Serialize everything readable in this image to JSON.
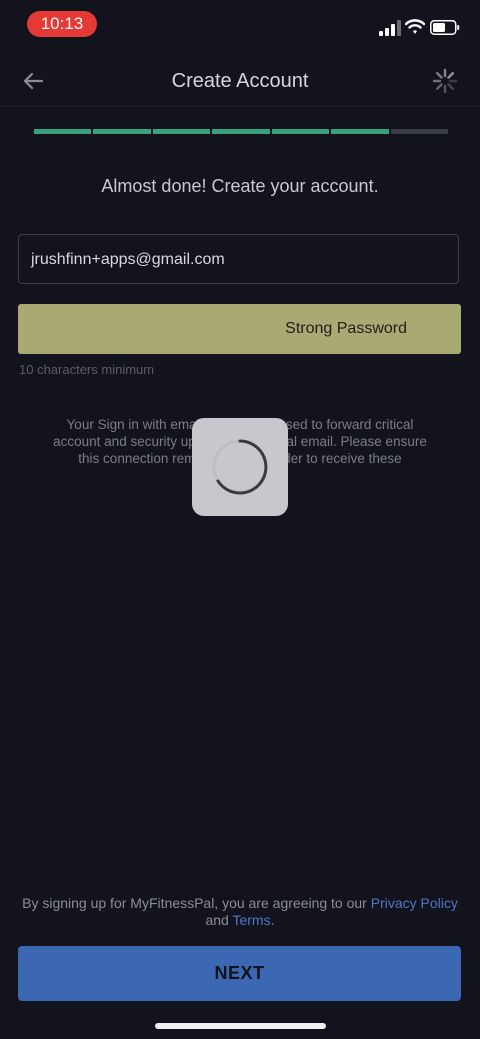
{
  "status": {
    "time": "10:13",
    "icons": [
      "cellular-signal-icon",
      "wifi-icon",
      "battery-icon"
    ]
  },
  "nav": {
    "title": "Create Account",
    "back_icon": "back-arrow-icon",
    "loading_icon": "spinner-icon"
  },
  "progress": {
    "total_steps": 7,
    "completed_steps": 6
  },
  "heading": "Almost done! Create your account.",
  "email": {
    "value": "jrushfinn+apps@gmail.com"
  },
  "password": {
    "strength_label": "Strong Password",
    "hint": "10 characters minimum"
  },
  "info": {
    "line1": "Your Sign in with email a          used to forward critical",
    "line2": "account and security upda        sonal email. Please ensure",
    "line3": "this connection remain         order to receive these"
  },
  "terms": {
    "prefix": "By signing up for MyFitnessPal, you are agreeing to our ",
    "privacy_link": "Privacy Policy",
    "and": " and ",
    "terms_link": "Terms",
    "suffix": "."
  },
  "next_button": "NEXT",
  "colors": {
    "background": "#12131d",
    "progress_done": "#39a27a",
    "strength_strong": "#a9a973",
    "primary_button": "#3c67b2",
    "link": "#4e77c9",
    "status_time_pill": "#e53935"
  }
}
